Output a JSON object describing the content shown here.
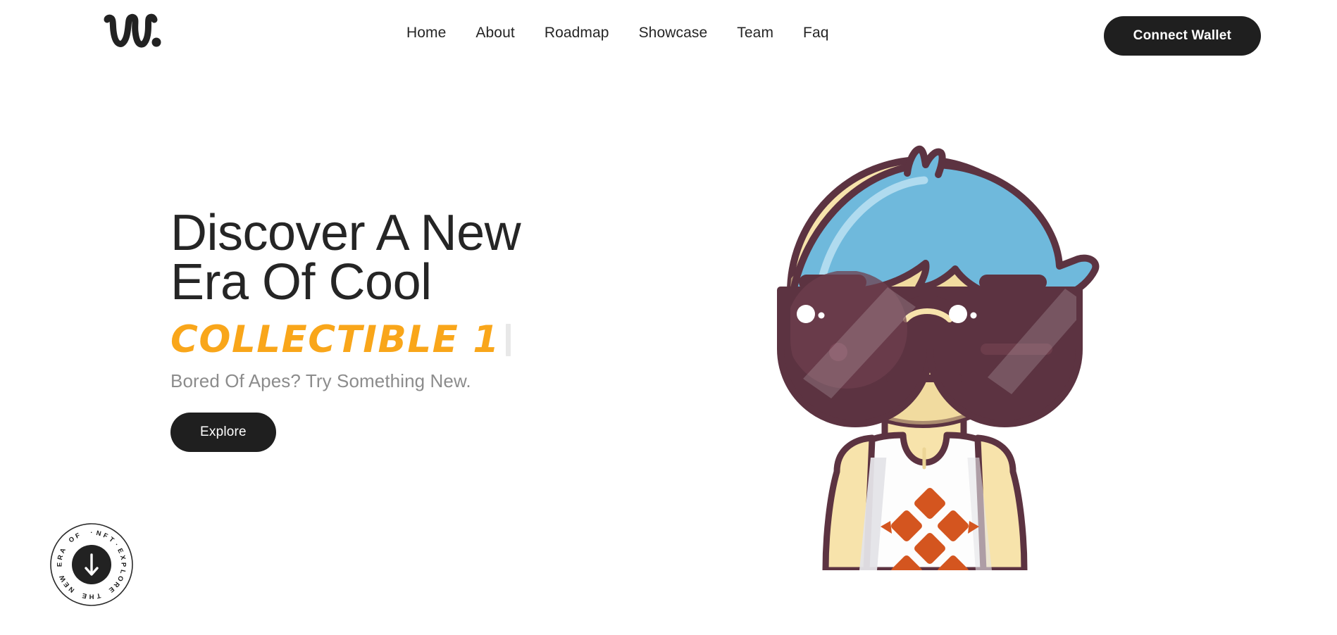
{
  "brand": {
    "logo_text": "w.",
    "logo_icon": "script-w-logo"
  },
  "header": {
    "nav_items": [
      {
        "label": "Home",
        "name": "nav-link-home"
      },
      {
        "label": "About",
        "name": "nav-link-about"
      },
      {
        "label": "Roadmap",
        "name": "nav-link-roadmap"
      },
      {
        "label": "Showcase",
        "name": "nav-link-showcase"
      },
      {
        "label": "Team",
        "name": "nav-link-team"
      },
      {
        "label": "Faq",
        "name": "nav-link-faq"
      }
    ],
    "connect_wallet_label": "Connect Wallet"
  },
  "hero": {
    "title": "Discover A New\nEra Of Cool",
    "typed_text": "COLLECTIBLE 1",
    "subtitle": "Bored Of Apes? Try Something New.",
    "cta_label": "Explore"
  },
  "scroll_badge": {
    "ring_text": "· NFT · EXPLORE THE NEW ERA OF",
    "arrow_icon": "arrow-down-icon",
    "letters": [
      "·",
      "N",
      "F",
      "T",
      "·",
      "E",
      "X",
      "P",
      "L",
      "O",
      "R",
      "E",
      " ",
      "T",
      "H",
      "E",
      " ",
      "N",
      "E",
      "W",
      " ",
      "E",
      "R",
      "A",
      " ",
      "O",
      "F",
      " "
    ]
  },
  "illustration": {
    "name": "nft-avatar-character",
    "description": "Cartoon character with blue hair, dark sunglasses and white tank top with orange pineapple graphic"
  },
  "colors": {
    "accent_orange": "#f9a61a",
    "dark": "#1f1f1f",
    "text_primary": "#252525",
    "text_muted": "#8c8c8c",
    "background": "#ffffff",
    "hair_blue": "#6fb9dc",
    "hair_blue_light": "#9ed2ea",
    "skin": "#f7e3ab",
    "skin_shade": "#ecd596",
    "outline": "#5c3341",
    "glasses_lens": "#5c3341",
    "shirt_white": "#fdfdfd",
    "shirt_shade": "#e4e4e8",
    "logo_orange": "#d4551f"
  }
}
